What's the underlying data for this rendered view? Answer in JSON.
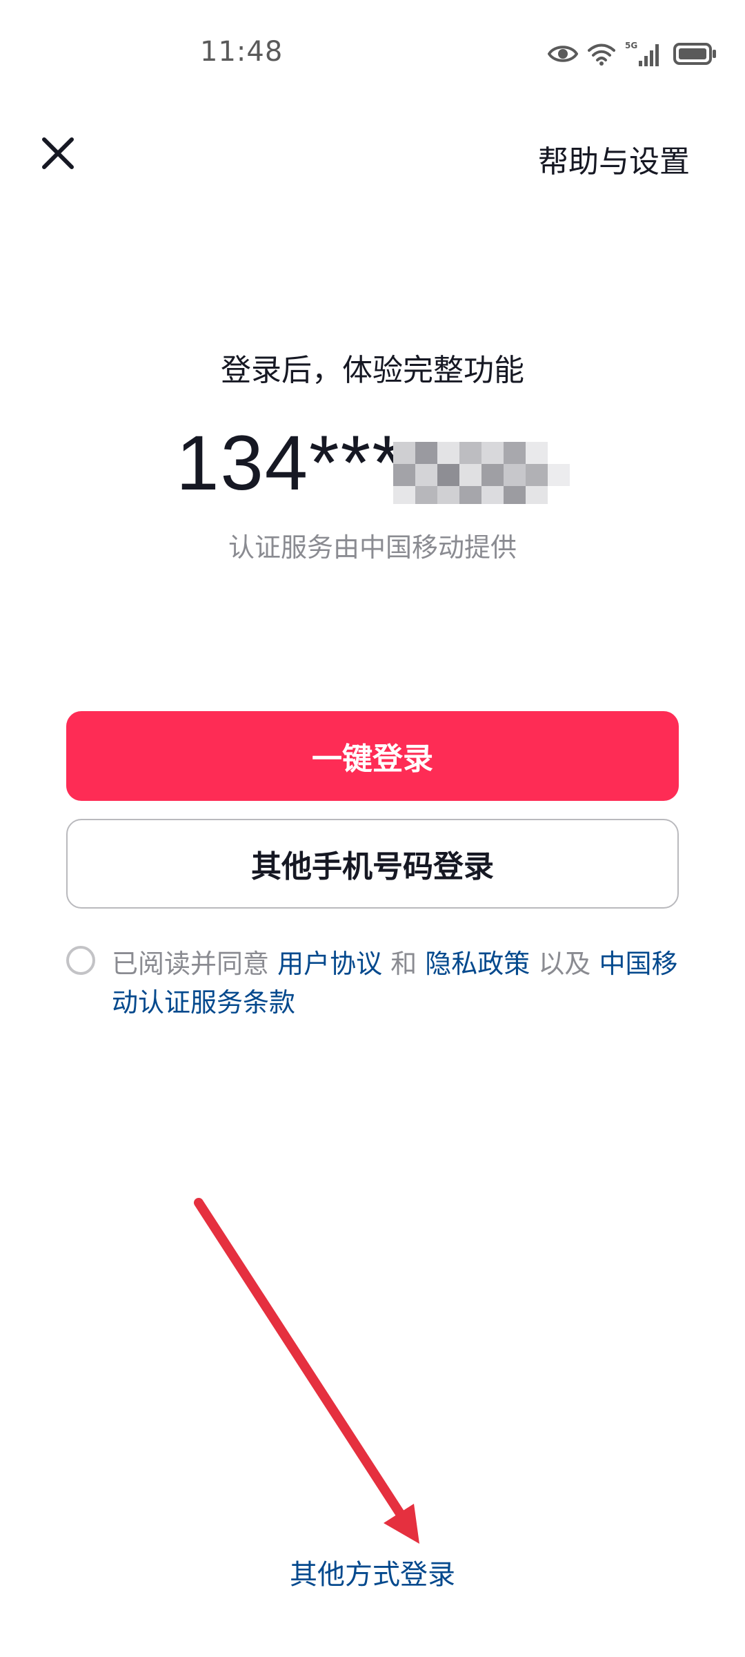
{
  "status_bar": {
    "time": "11:48",
    "network_label": "5G",
    "icons": [
      "eye-icon",
      "wifi-icon",
      "signal-icon",
      "battery-icon"
    ]
  },
  "nav": {
    "close_icon": "close-icon",
    "help_label": "帮助与设置"
  },
  "header": {
    "title": "登录后，体验完整功能",
    "phone_number": "134***",
    "auth_note": "认证服务由中国移动提供"
  },
  "buttons": {
    "one_click_login": "一键登录",
    "other_phone_login": "其他手机号码登录"
  },
  "agreement": {
    "prefix": "已阅读并同意 ",
    "user_agreement": "用户协议",
    "and": " 和 ",
    "privacy_policy": "隐私政策",
    "as_well_as": " 以及 ",
    "cmcc_terms": "中国移动认证服务条款"
  },
  "footer": {
    "other_methods": "其他方式登录"
  },
  "colors": {
    "primary": "#fe2c55",
    "link": "#04498d",
    "annotation": "#e5303f"
  }
}
